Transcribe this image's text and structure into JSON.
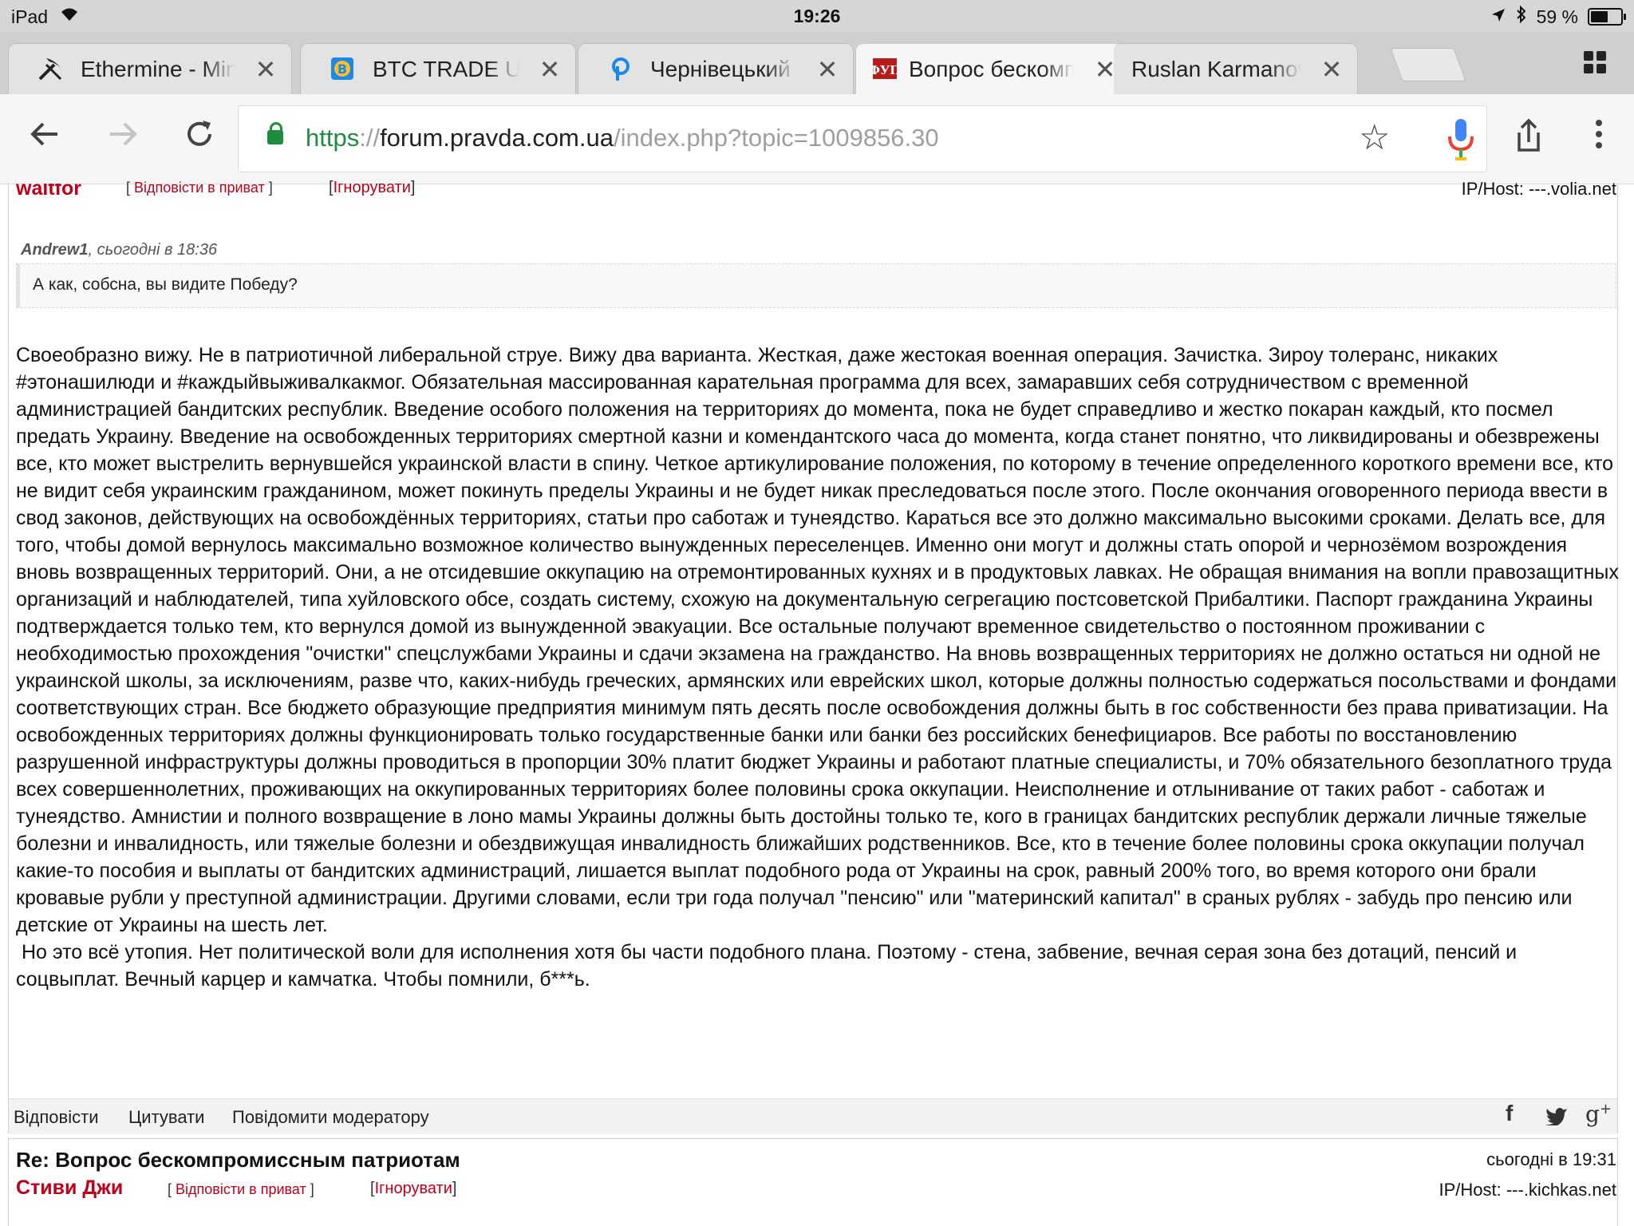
{
  "status_bar": {
    "carrier": "iPad",
    "time": "19:26",
    "battery_text": "59 %",
    "battery_level": 0.59
  },
  "tabs": [
    {
      "title": "Ethermine - Miner",
      "icon": "pickaxe-icon"
    },
    {
      "title": "BTC TRADE UA -",
      "icon": "btc-trade-icon"
    },
    {
      "title": "Чернівецький фо",
      "icon": "forum-icon"
    },
    {
      "title": "Вопрос бескомп",
      "icon": "pravda-forum-icon",
      "active": true
    },
    {
      "title": "Ruslan Karmanov",
      "icon": ""
    }
  ],
  "address_bar": {
    "scheme": "https",
    "separator": "://",
    "host": "forum.pravda.com.ua",
    "path": "/index.php?topic=1009856.30"
  },
  "post1": {
    "author_partial": "waltfor",
    "private_reply": "Відповісти в приват",
    "ignore": "Ігнорувати",
    "iphost": "IP/Host: ---.volia.net",
    "quote_author": "Andrew1",
    "quote_time": ", сьогодні в 18:36",
    "quote_text": "А как, собсна, вы видите Победу?",
    "body": "Своеобразно вижу. Не в патриотичной либеральной струе. Вижу два варианта. Жесткая, даже жестокая военная операция. Зачистка. Зироу толеранс, никаких #этонашилюди и #каждыйвыживалкакмог. Обязательная массированная карательная программа для всех, замаравших себя сотрудничеством с временной администрацией бандитских республик. Введение особого положения на территориях до момента, пока не будет справедливо и жестко покаран каждый, кто посмел предать Украину. Введение на освобожденных территориях смертной казни и комендантского часа до момента, когда станет понятно, что ликвидированы и обезврежены все, кто может выстрелить вернувшейся украинской власти в спину. Четкое артикулирование положения, по которому в течение определенного короткого времени все, кто не видит себя украинским гражданином, может покинуть пределы Украины и не будет никак преследоваться после этого. После окончания оговоренного периода ввести в свод законов, действующих на освобождённых территориях, статьи про саботаж и тунеядство. Караться все это должно максимально высокими сроками. Делать все, для того, чтобы домой вернулось максимально возможное количество вынужденных переселенцев. Именно они могут и должны стать опорой и чернозёмом возрождения вновь возвращенных территорий. Они, а не отсидевшие оккупацию на отремонтированных кухнях и в продуктовых лавках. Не обращая внимания на вопли правозащитных организаций и наблюдателей, типа хуйловского обсе, создать систему, схожую на документальную сегрегацию постсоветской Прибалтики. Паспорт гражданина Украины подтверждается только тем, кто вернулся домой из вынужденной эвакуации. Все остальные получают временное свидетельство о постоянном проживании с необходимостью прохождения \"очистки\" спецслужбами Украины и сдачи экзамена на гражданство. На вновь возвращенных территориях не должно остаться ни одной не украинской школы, за исключениям, разве что, каких-нибудь греческих, армянских или еврейских школ, которые должны полностью содержаться посольствами и фондами соответствующих стран. Все бюджето образующие предприятия минимум пять десять после освобождения должны быть в гос собственности без права приватизации. На освобожденных территориях должны функционировать только государственные банки или банки без российских бенефициаров. Все работы по восстановлению разрушенной инфраструктуры должны проводиться в пропорции 30% платит бюджет Украины и работают платные специалисты, и 70% обязательного безоплатного труда всех совершеннолетних, проживающих на оккупированных территориях более половины срока оккупации. Неисполнение и отлынивание от таких работ - саботаж и тунеядство. Амнистии и полного возвращение в лоно мамы Украины должны быть достойны только те, кого в границах бандитских республик держали личные тяжелые болезни и инвалидность, или тяжелые болезни и обездвижущая инвалидность ближайших родственников. Все, кто в течение более половины срока оккупации получал какие-то пособия и выплаты от бандитских администраций, лишается выплат подобного рода от Украины на срок, равный 200% того, во время которого они брали кровавые рубли у преступной администрации. Другими словами, если три года получал \"пенсию\" или \"материнский капитал\" в сраных рублях - забудь про пенсию или детские от Украины на шесть лет.",
    "body2": " Но это всё утопия. Нет политической воли для исполнения хотя бы части подобного плана. Поэтому - стена, забвение, вечная серая зона без дотаций, пенсий и соцвыплат. Вечный карцер и камчатка. Чтобы помнили, б***ь.",
    "actions": {
      "reply": "Відповісти",
      "quote": "Цитувати",
      "report": "Повідомити модератору"
    },
    "share": {
      "facebook": "f",
      "twitter": "twitter-bird",
      "gplus": "g+"
    }
  },
  "post2": {
    "title": "Re: Вопрос бескомпромиссным патриотам",
    "time": "сьогодні в 19:31",
    "author": "Стиви Джи",
    "private_reply": "Відповісти в приват",
    "ignore": "Ігнорувати",
    "iphost": "IP/Host: ---.kichkas.net"
  }
}
